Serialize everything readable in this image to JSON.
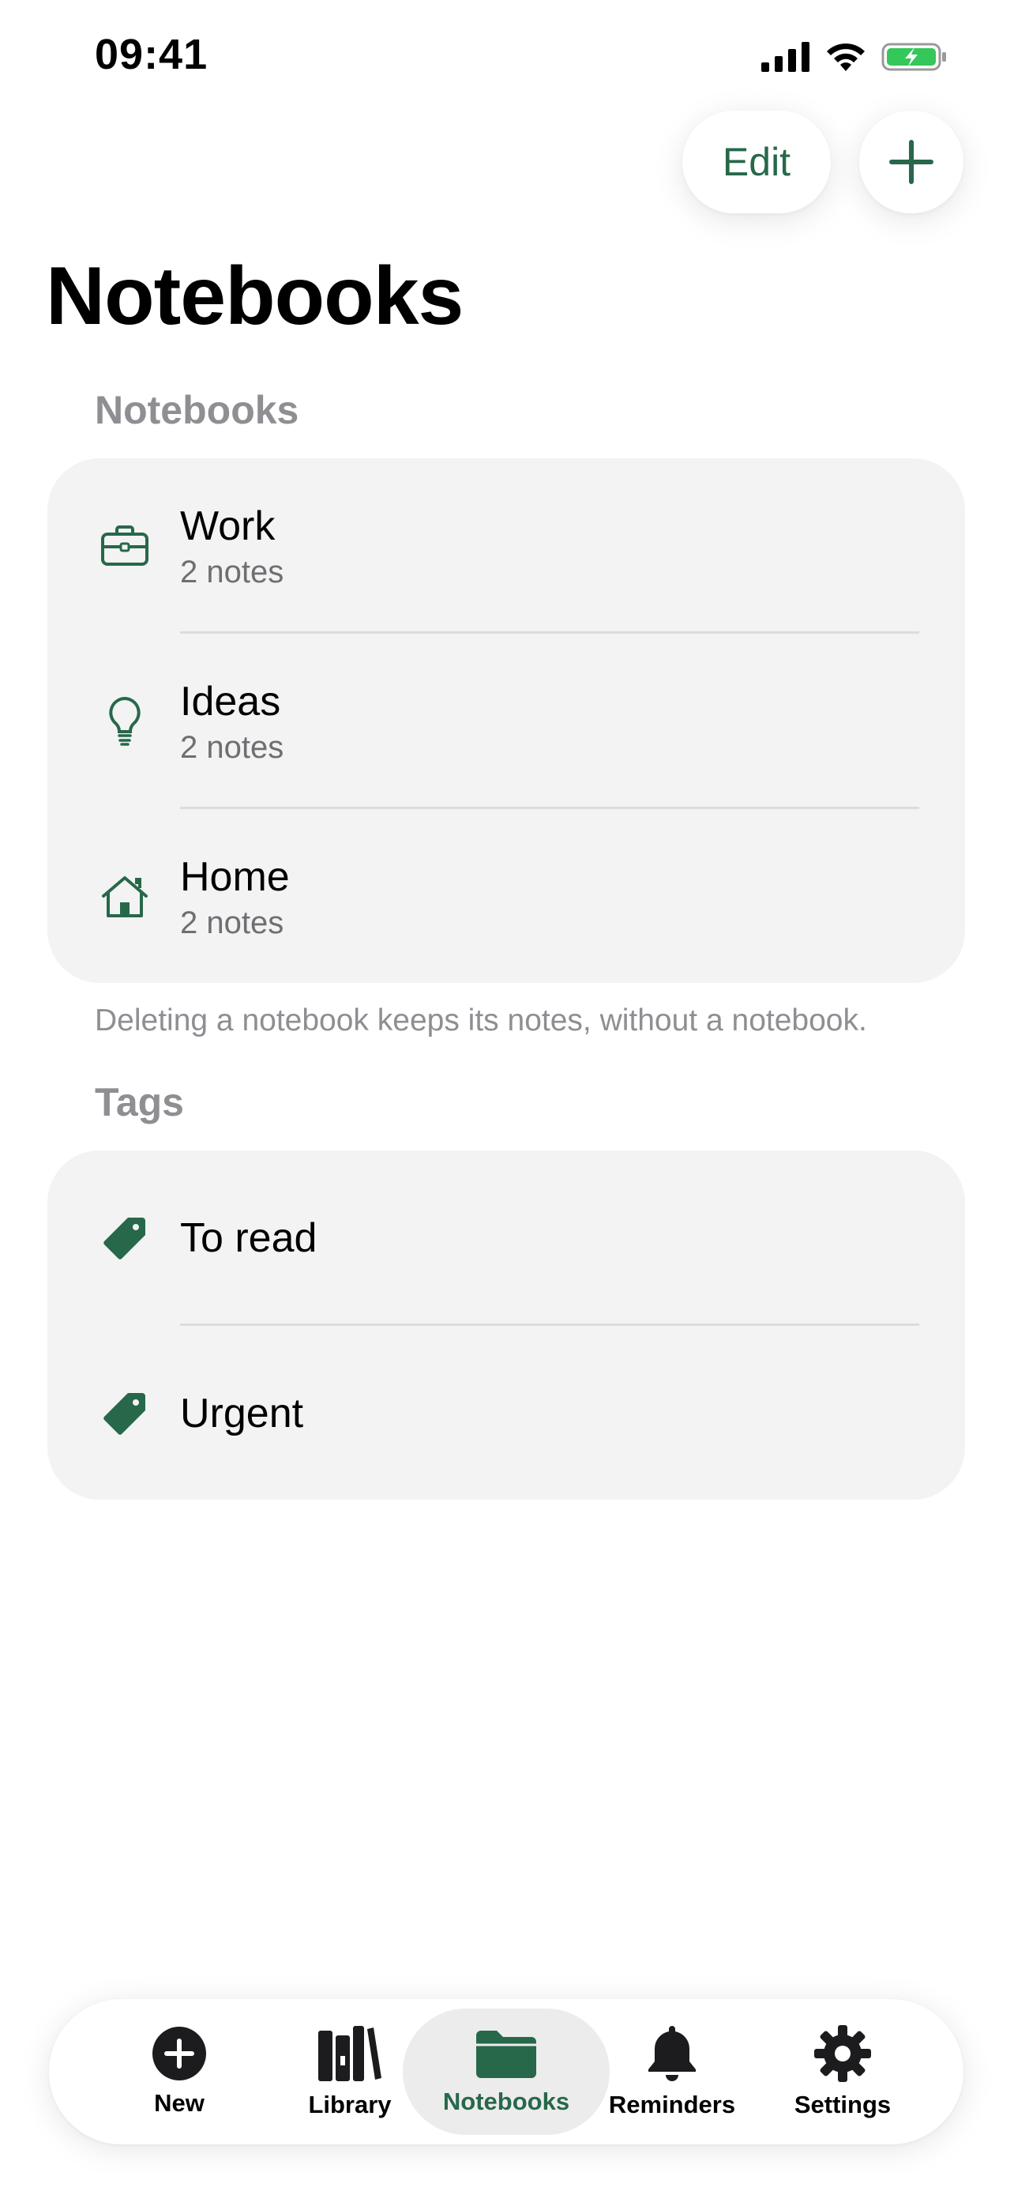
{
  "status_bar": {
    "time": "09:41"
  },
  "header": {
    "edit_label": "Edit",
    "page_title": "Notebooks"
  },
  "notebooks_section": {
    "header": "Notebooks",
    "items": [
      {
        "icon": "briefcase-icon",
        "title": "Work",
        "subtitle": "2 notes"
      },
      {
        "icon": "lightbulb-icon",
        "title": "Ideas",
        "subtitle": "2 notes"
      },
      {
        "icon": "house-icon",
        "title": "Home",
        "subtitle": "2 notes"
      }
    ],
    "footer": "Deleting a notebook keeps its notes, without a notebook."
  },
  "tags_section": {
    "header": "Tags",
    "items": [
      {
        "icon": "tag-icon",
        "title": "To read"
      },
      {
        "icon": "tag-icon",
        "title": "Urgent"
      }
    ]
  },
  "tab_bar": {
    "tabs": [
      {
        "label": "New",
        "icon": "plus-circle-icon"
      },
      {
        "label": "Library",
        "icon": "books-icon"
      },
      {
        "label": "Notebooks",
        "icon": "folder-icon",
        "active": true
      },
      {
        "label": "Reminders",
        "icon": "bell-icon"
      },
      {
        "label": "Settings",
        "icon": "gear-icon"
      }
    ]
  },
  "colors": {
    "accent": "#27684a",
    "card_bg": "#f3f3f3",
    "secondary_text": "#8e8e93"
  }
}
